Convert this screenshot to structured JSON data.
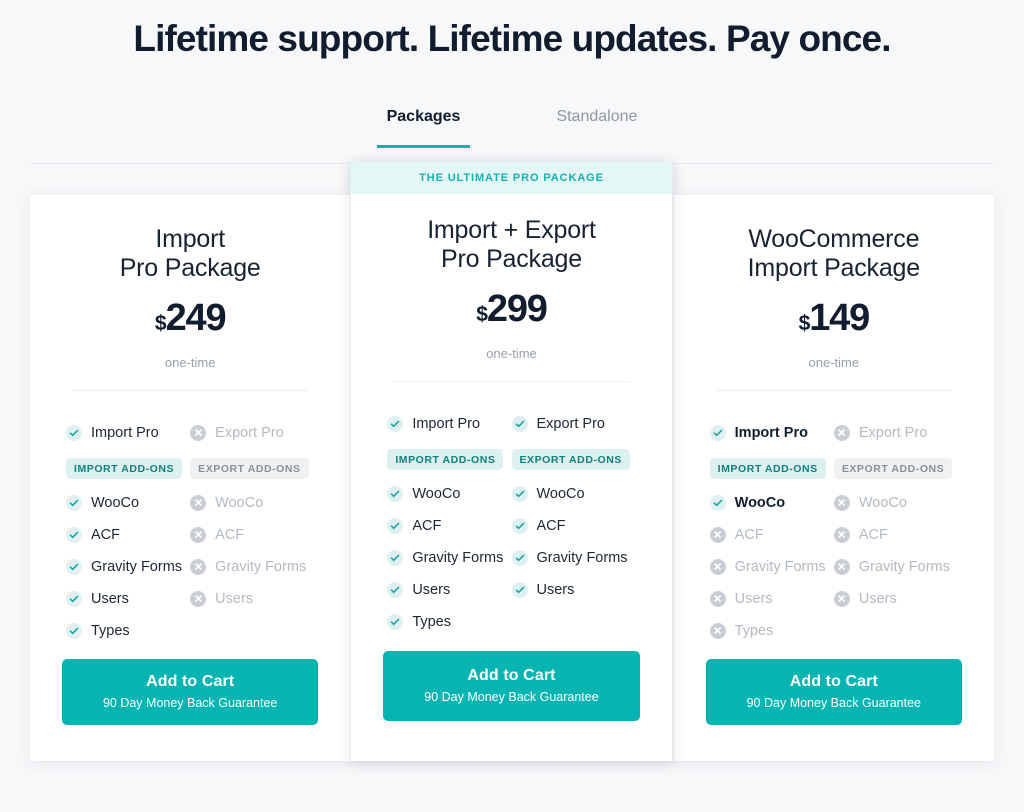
{
  "heading": "Lifetime support. Lifetime updates. Pay once.",
  "tabs": [
    {
      "label": "Packages",
      "active": true
    },
    {
      "label": "Standalone",
      "active": false
    }
  ],
  "colors": {
    "teal": "#06b4b2",
    "teal_accent": "#12b2b0",
    "teal_badge_bg": "#ddf1f0",
    "gray_badge_bg": "#f0f1f3",
    "dark_text": "#111c2e",
    "muted_text": "#b4bac2",
    "page_bg": "#f7f8fa",
    "banner_bg": "#e5f6f6"
  },
  "cards": [
    {
      "featured": false,
      "banner": "",
      "title_line1": "Import",
      "title_line2": "Pro Package",
      "currency": "$",
      "amount": "249",
      "note": "one-time",
      "import_col": {
        "header": {
          "label": "Import Pro",
          "state": "on",
          "strong": false
        },
        "badge": "IMPORT ADD-ONS",
        "badge_style": "teal",
        "items": [
          {
            "label": "WooCo",
            "state": "on",
            "strong": false
          },
          {
            "label": "ACF",
            "state": "on",
            "strong": false
          },
          {
            "label": "Gravity Forms",
            "state": "on",
            "strong": false
          },
          {
            "label": "Users",
            "state": "on",
            "strong": false
          },
          {
            "label": "Types",
            "state": "on",
            "strong": false
          }
        ]
      },
      "export_col": {
        "header": {
          "label": "Export Pro",
          "state": "off",
          "strong": false
        },
        "badge": "EXPORT ADD-ONS",
        "badge_style": "gray",
        "items": [
          {
            "label": "WooCo",
            "state": "off",
            "strong": false
          },
          {
            "label": "ACF",
            "state": "off",
            "strong": false
          },
          {
            "label": "Gravity Forms",
            "state": "off",
            "strong": false
          },
          {
            "label": "Users",
            "state": "off",
            "strong": false
          }
        ]
      },
      "cta_title": "Add to Cart",
      "cta_sub": "90 Day Money Back Guarantee"
    },
    {
      "featured": true,
      "banner": "THE ULTIMATE PRO PACKAGE",
      "title_line1": "Import + Export",
      "title_line2": "Pro Package",
      "currency": "$",
      "amount": "299",
      "note": "one-time",
      "import_col": {
        "header": {
          "label": "Import Pro",
          "state": "on",
          "strong": false
        },
        "badge": "IMPORT ADD-ONS",
        "badge_style": "teal",
        "items": [
          {
            "label": "WooCo",
            "state": "on",
            "strong": false
          },
          {
            "label": "ACF",
            "state": "on",
            "strong": false
          },
          {
            "label": "Gravity Forms",
            "state": "on",
            "strong": false
          },
          {
            "label": "Users",
            "state": "on",
            "strong": false
          },
          {
            "label": "Types",
            "state": "on",
            "strong": false
          }
        ]
      },
      "export_col": {
        "header": {
          "label": "Export Pro",
          "state": "on",
          "strong": false
        },
        "badge": "EXPORT ADD-ONS",
        "badge_style": "teal",
        "items": [
          {
            "label": "WooCo",
            "state": "on",
            "strong": false
          },
          {
            "label": "ACF",
            "state": "on",
            "strong": false
          },
          {
            "label": "Gravity Forms",
            "state": "on",
            "strong": false
          },
          {
            "label": "Users",
            "state": "on",
            "strong": false
          }
        ]
      },
      "cta_title": "Add to Cart",
      "cta_sub": "90 Day Money Back Guarantee"
    },
    {
      "featured": false,
      "banner": "",
      "title_line1": "WooCommerce",
      "title_line2": "Import Package",
      "currency": "$",
      "amount": "149",
      "note": "one-time",
      "import_col": {
        "header": {
          "label": "Import Pro",
          "state": "on",
          "strong": true
        },
        "badge": "IMPORT ADD-ONS",
        "badge_style": "teal",
        "items": [
          {
            "label": "WooCo",
            "state": "on",
            "strong": true
          },
          {
            "label": "ACF",
            "state": "off",
            "strong": false
          },
          {
            "label": "Gravity Forms",
            "state": "off",
            "strong": false
          },
          {
            "label": "Users",
            "state": "off",
            "strong": false
          },
          {
            "label": "Types",
            "state": "off",
            "strong": false
          }
        ]
      },
      "export_col": {
        "header": {
          "label": "Export Pro",
          "state": "off",
          "strong": false
        },
        "badge": "EXPORT ADD-ONS",
        "badge_style": "gray",
        "items": [
          {
            "label": "WooCo",
            "state": "off",
            "strong": false
          },
          {
            "label": "ACF",
            "state": "off",
            "strong": false
          },
          {
            "label": "Gravity Forms",
            "state": "off",
            "strong": false
          },
          {
            "label": "Users",
            "state": "off",
            "strong": false
          }
        ]
      },
      "cta_title": "Add to Cart",
      "cta_sub": "90 Day Money Back Guarantee"
    }
  ]
}
